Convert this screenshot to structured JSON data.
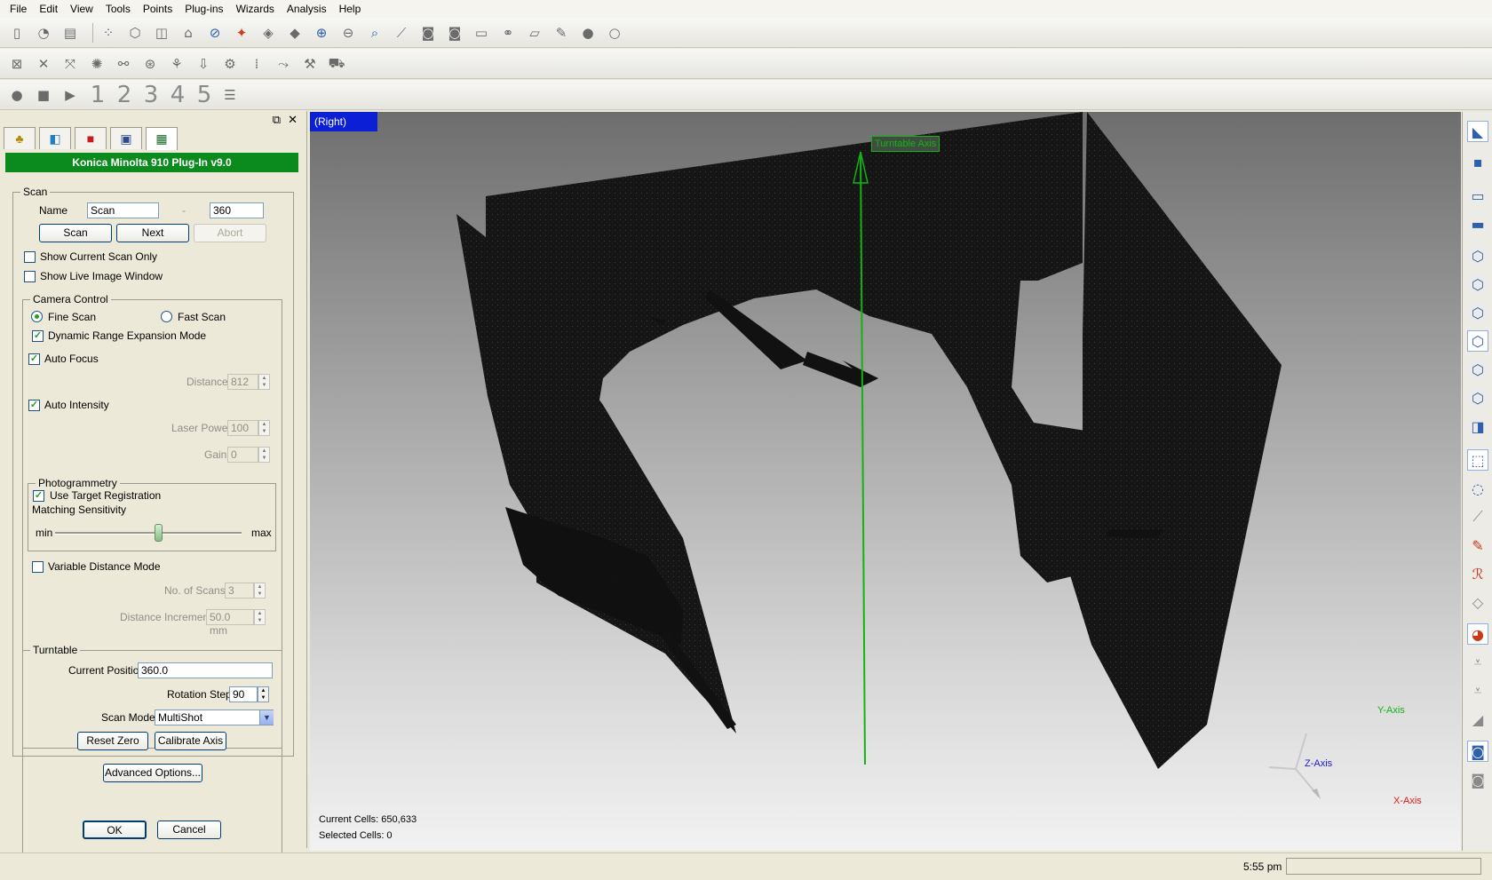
{
  "menu": [
    "File",
    "Edit",
    "View",
    "Tools",
    "Points",
    "Plug-ins",
    "Wizards",
    "Analysis",
    "Help"
  ],
  "toolbar3": {
    "scan_numbers": [
      "1",
      "2",
      "3",
      "4",
      "5"
    ]
  },
  "panel": {
    "header": "Konica Minolta 910 Plug-In v9.0",
    "scan": {
      "legend": "Scan",
      "name_label": "Name",
      "name_value": "Scan",
      "separator": "-",
      "number_value": "360",
      "scan_button": "Scan",
      "next_button": "Next",
      "abort_button": "Abort",
      "show_current_scan_only": "Show Current Scan Only",
      "show_live_image_window": "Show Live Image Window"
    },
    "camera": {
      "legend": "Camera Control",
      "fine_scan": "Fine Scan",
      "fast_scan": "Fast Scan",
      "dynamic_range": "Dynamic Range Expansion Mode",
      "auto_focus": "Auto Focus",
      "distance_label": "Distance",
      "distance_value": "812",
      "auto_intensity": "Auto Intensity",
      "laser_power_label": "Laser Power",
      "laser_power_value": "100",
      "gain_label": "Gain",
      "gain_value": "0"
    },
    "photogrammetry": {
      "legend": "Photogrammetry",
      "use_target_registration": "Use Target Registration",
      "matching_sensitivity": "Matching Sensitivity",
      "min_label": "min",
      "max_label": "max",
      "sensitivity_level": 0.55
    },
    "variable": {
      "label": "Variable Distance Mode",
      "no_scans_label": "No. of Scans",
      "no_scans_value": "3",
      "distance_increment_label": "Distance Increment",
      "distance_increment_value": "50.0 mm"
    },
    "turntable": {
      "legend": "Turntable",
      "current_position_label": "Current Position",
      "current_position_value": "360.0",
      "rotation_step_label": "Rotation Step",
      "rotation_step_value": "90",
      "scan_mode_label": "Scan Mode",
      "scan_mode_value": "MultiShot",
      "reset_zero": "Reset Zero",
      "calibrate_axis": "Calibrate Axis"
    },
    "advanced_options": "Advanced Options...",
    "ok": "OK",
    "cancel": "Cancel"
  },
  "viewport": {
    "view_name": "(Right)",
    "turntable_axis_label": "Turntable Axis",
    "current_cells": "Current Cells: 650,633",
    "selected_cells": "Selected Cells: 0",
    "axis_y": "Y-Axis",
    "axis_z": "Z-Axis",
    "axis_x": "X-Axis"
  },
  "status": {
    "time": "5:55 pm"
  },
  "colors": {
    "plugin_header": "#0b8a1e",
    "view_label_bg": "#0a1fd6",
    "turntable_axis": "#13b313",
    "axis_y": "#13b313",
    "axis_z": "#1a1ad6",
    "axis_x": "#e01a1a"
  }
}
